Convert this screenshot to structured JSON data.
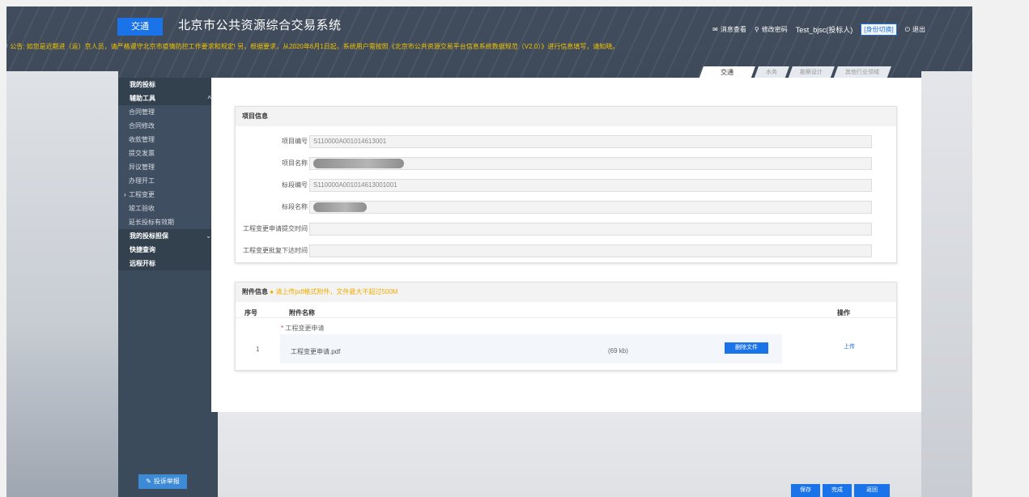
{
  "header": {
    "tag": "交通",
    "title": "北京市公共资源综合交易系统",
    "links": {
      "messages": "消息查看",
      "change_password": "修改密码",
      "user": "Test_bjsc(投标人)",
      "role_switch": "[身份切换]",
      "logout": "退出"
    },
    "notice": "公告: 如您是近期进（返）京人员，请严格遵守北京市疫情防控工作要求和规定! 另，根据要求，从2020年6月1日起，系统用户需按照《北京市公共资源交易平台信息系统数据规范（V2.0）》进行信息填写，请知晓。",
    "tabs": [
      "交通",
      "水务",
      "勘察设计",
      "其他行业领域"
    ]
  },
  "sidebar": {
    "items": [
      {
        "label": "我的投标",
        "type": "group"
      },
      {
        "label": "辅助工具",
        "type": "group-open"
      },
      {
        "label": "合同管理",
        "type": "sub"
      },
      {
        "label": "合同修改",
        "type": "sub"
      },
      {
        "label": "收款管理",
        "type": "sub"
      },
      {
        "label": "提交发票",
        "type": "sub"
      },
      {
        "label": "异议管理",
        "type": "sub"
      },
      {
        "label": "办理开工",
        "type": "sub"
      },
      {
        "label": "工程变更",
        "type": "sub-current"
      },
      {
        "label": "竣工验收",
        "type": "sub"
      },
      {
        "label": "延长投标有效期",
        "type": "sub"
      },
      {
        "label": "我的投标担保",
        "type": "group"
      },
      {
        "label": "快捷查询",
        "type": "group"
      },
      {
        "label": "远程开标",
        "type": "group"
      }
    ],
    "complaint_label": "投诉举报"
  },
  "project": {
    "heading": "项目信息",
    "fields": {
      "project_no_label": "项目编号",
      "project_no": "S110000A001014613001",
      "project_name_label": "项目名称",
      "section_no_label": "标段编号",
      "section_no": "S110000A001014613001001",
      "section_name_label": "标段名称",
      "submit_time_label": "工程变更申请提交时间",
      "approve_time_label": "工程变更批复下达时间"
    }
  },
  "attachments": {
    "heading": "附件信息",
    "tip": "请上传pdf格式附件，文件最大不超过500M",
    "col_no": "序号",
    "col_name": "附件名称",
    "col_action": "操作",
    "row_no": "1",
    "required_name": "工程变更申请",
    "file_name": "工程变更申请.pdf",
    "file_size": "(69 kb)",
    "delete_label": "删除文件",
    "upload_label": "上传"
  },
  "actions": {
    "save": "保存",
    "done": "完成",
    "back": "返回"
  }
}
